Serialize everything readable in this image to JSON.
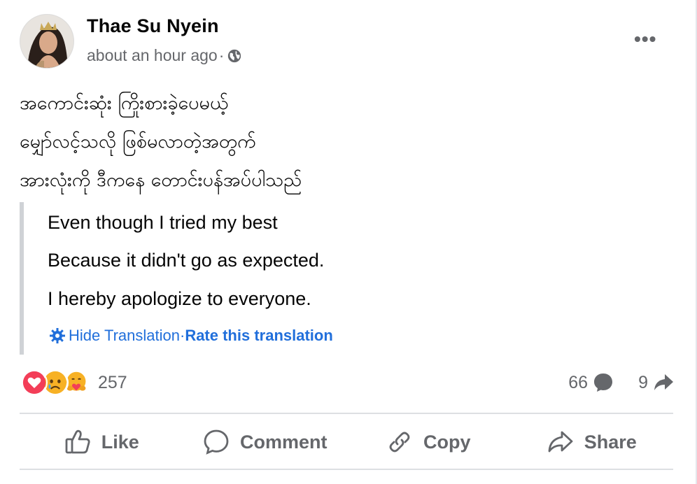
{
  "post": {
    "author": "Thae Su Nyein",
    "time": "about an hour ago",
    "time_separator": "·",
    "audience_icon": "globe-icon",
    "more_icon": "more-options-icon",
    "text_lines": [
      "အကောင်းဆုံး ကြိုးစားခဲ့ပေမယ့်",
      "မျှော်လင့်သလို ဖြစ်မလာတဲ့အတွက်",
      "အားလုံးကို ဒီကနေ တောင်းပန်အပ်ပါသည်"
    ]
  },
  "translation": {
    "lines": [
      "Even though I tried my best",
      "Because it didn't go as expected.",
      "I hereby apologize to everyone."
    ],
    "hide_label": "Hide Translation",
    "separator": "·",
    "rate_label": "Rate this translation",
    "gear_icon": "gear-icon"
  },
  "reactions": {
    "icons": [
      "love-reaction-icon",
      "sad-reaction-icon",
      "care-reaction-icon"
    ],
    "count": "257"
  },
  "stats": {
    "comments": "66",
    "comment_icon": "comment-bubble-icon",
    "shares": "9",
    "share_icon": "share-arrow-icon"
  },
  "actions": {
    "like": "Like",
    "comment": "Comment",
    "copy": "Copy",
    "share": "Share"
  },
  "colors": {
    "link_blue": "#216fdb",
    "secondary_text": "#65676b",
    "love_red": "#f33e58",
    "emoji_yellow": "#f7b125"
  }
}
